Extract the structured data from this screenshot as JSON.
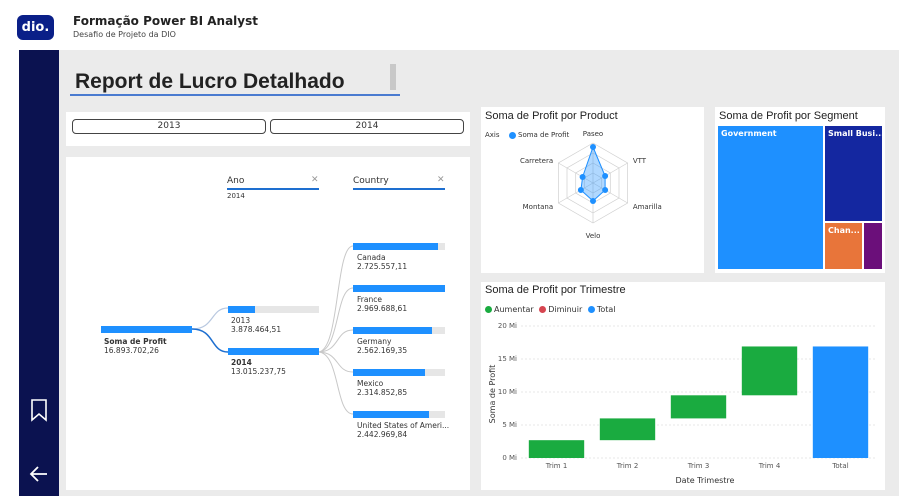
{
  "app": {
    "logo_text": "dio.",
    "title": "Formação Power BI Analyst",
    "subtitle": "Desafio de Projeto da DIO"
  },
  "nav": {
    "bookmark_icon": "bookmark-icon",
    "back_icon": "arrow-left-icon"
  },
  "page": {
    "title": "Report de Lucro Detalhado"
  },
  "slicer": {
    "options": [
      "2013",
      "2014"
    ]
  },
  "decomp": {
    "root": {
      "label": "Soma de Profit",
      "value": "16.893.702,26"
    },
    "ano_header": "Ano",
    "ano_filter": "2014",
    "country_header": "Country",
    "years": [
      {
        "label": "2013",
        "value": "3.878.464,51",
        "fill": 0.3
      },
      {
        "label": "2014",
        "value": "13.015.237,75",
        "fill": 1.0
      }
    ],
    "countries": [
      {
        "label": "Canada",
        "value": "2.725.557,11",
        "fill": 0.92
      },
      {
        "label": "France",
        "value": "2.969.688,61",
        "fill": 1.0
      },
      {
        "label": "Germany",
        "value": "2.562.169,35",
        "fill": 0.86
      },
      {
        "label": "Mexico",
        "value": "2.314.852,85",
        "fill": 0.78
      },
      {
        "label": "United States of Ameri...",
        "value": "2.442.969,84",
        "fill": 0.82
      }
    ]
  },
  "radar": {
    "title": "Soma de Profit por Product",
    "legend_axis": "Axis",
    "legend_series": "Soma de Profit",
    "labels": [
      "Paseo",
      "VTT",
      "Amarilla",
      "Velo",
      "Montana",
      "Carretera"
    ]
  },
  "treemap": {
    "title": "Soma de Profit por Segment",
    "cells": [
      "Government",
      "Small Busi...",
      "Chan...",
      ""
    ]
  },
  "waterfall": {
    "title": "Soma de Profit por Trimestre",
    "legend": [
      {
        "label": "Aumentar",
        "color": "#1aab40"
      },
      {
        "label": "Diminuir",
        "color": "#d64550"
      },
      {
        "label": "Total",
        "color": "#1e90ff"
      }
    ],
    "ylabel": "Soma de Profit",
    "xlabel": "Date Trimestre",
    "yticks": [
      "0 Mi",
      "5 Mi",
      "10 Mi",
      "15 Mi",
      "20 Mi"
    ]
  },
  "chart_data": [
    {
      "type": "radar",
      "title": "Soma de Profit por Product",
      "categories": [
        "Paseo",
        "VTT",
        "Amarilla",
        "Velo",
        "Montana",
        "Carretera"
      ],
      "series": [
        {
          "name": "Soma de Profit",
          "values": [
            0.9,
            0.35,
            0.35,
            0.45,
            0.35,
            0.3
          ]
        }
      ]
    },
    {
      "type": "treemap",
      "title": "Soma de Profit por Segment",
      "categories": [
        "Government",
        "Small Busi...",
        "Chan...",
        ""
      ],
      "values": [
        11.4,
        4.1,
        1.0,
        0.5
      ]
    },
    {
      "type": "bar",
      "title": "Soma de Profit por Trimestre",
      "categories": [
        "Trim 1",
        "Trim 2",
        "Trim 3",
        "Trim 4",
        "Total"
      ],
      "values": [
        2.7,
        3.3,
        3.5,
        7.4,
        16.9
      ],
      "xlabel": "Date Trimestre",
      "ylabel": "Soma de Profit",
      "ylim": [
        0,
        20
      ]
    }
  ]
}
